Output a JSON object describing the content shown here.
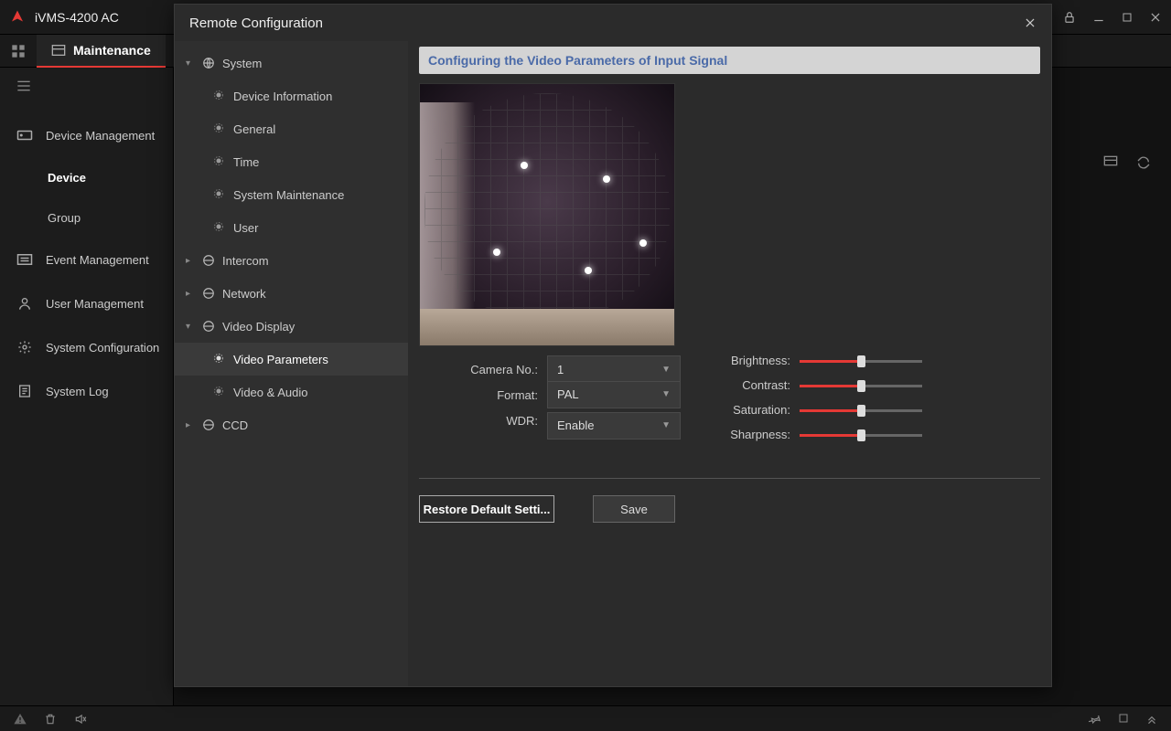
{
  "app": {
    "title": "iVMS-4200 AC"
  },
  "tab": {
    "label": "Maintenance"
  },
  "sidebar": {
    "items": [
      {
        "label": "Device Management"
      },
      {
        "label": "Device"
      },
      {
        "label": "Group"
      },
      {
        "label": "Event Management"
      },
      {
        "label": "User Management"
      },
      {
        "label": "System Configuration"
      },
      {
        "label": "System Log"
      }
    ]
  },
  "dialog": {
    "title": "Remote Configuration",
    "section_title": "Configuring the Video Parameters of Input Signal",
    "tree": {
      "system": {
        "label": "System",
        "children": {
          "device_info": "Device Information",
          "general": "General",
          "time": "Time",
          "maintenance": "System Maintenance",
          "user": "User"
        }
      },
      "intercom": {
        "label": "Intercom"
      },
      "network": {
        "label": "Network"
      },
      "video_display": {
        "label": "Video Display",
        "children": {
          "video_params": "Video Parameters",
          "video_audio": "Video & Audio"
        }
      },
      "ccd": {
        "label": "CCD"
      }
    },
    "form": {
      "camera_no_label": "Camera No.:",
      "camera_no_value": "1",
      "format_label": "Format:",
      "format_value": "PAL",
      "wdr_label": "WDR:",
      "wdr_value": "Enable"
    },
    "sliders": {
      "brightness": {
        "label": "Brightness:",
        "value": 50
      },
      "contrast": {
        "label": "Contrast:",
        "value": 50
      },
      "saturation": {
        "label": "Saturation:",
        "value": 50
      },
      "sharpness": {
        "label": "Sharpness:",
        "value": 50
      }
    },
    "buttons": {
      "restore": "Restore Default Setti...",
      "save": "Save"
    }
  }
}
